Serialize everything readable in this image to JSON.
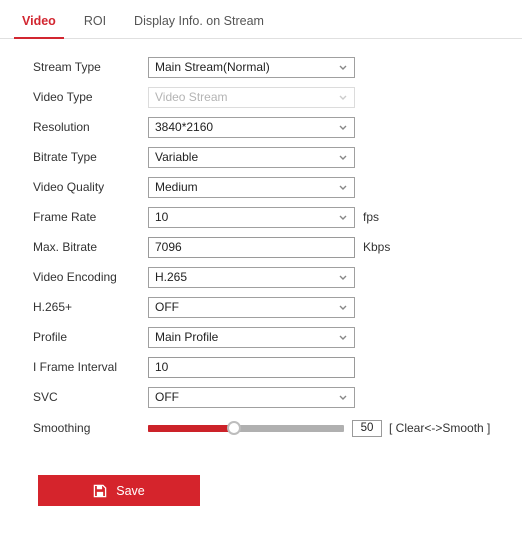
{
  "tabs": [
    {
      "label": "Video",
      "active": true
    },
    {
      "label": "ROI",
      "active": false
    },
    {
      "label": "Display Info. on Stream",
      "active": false
    }
  ],
  "form": {
    "rows": [
      {
        "label": "Stream Type",
        "value": "Main Stream(Normal)",
        "control": "select",
        "unit": "",
        "disabled": false
      },
      {
        "label": "Video Type",
        "value": "Video Stream",
        "control": "select",
        "unit": "",
        "disabled": true
      },
      {
        "label": "Resolution",
        "value": "3840*2160",
        "control": "select",
        "unit": "",
        "disabled": false
      },
      {
        "label": "Bitrate Type",
        "value": "Variable",
        "control": "select",
        "unit": "",
        "disabled": false
      },
      {
        "label": "Video Quality",
        "value": "Medium",
        "control": "select",
        "unit": "",
        "disabled": false
      },
      {
        "label": "Frame Rate",
        "value": "10",
        "control": "select",
        "unit": "fps",
        "disabled": false
      },
      {
        "label": "Max. Bitrate",
        "value": "7096",
        "control": "text",
        "unit": "Kbps",
        "disabled": false
      },
      {
        "label": "Video Encoding",
        "value": "H.265",
        "control": "select",
        "unit": "",
        "disabled": false
      },
      {
        "label": "H.265+",
        "value": "OFF",
        "control": "select",
        "unit": "",
        "disabled": false
      },
      {
        "label": "Profile",
        "value": "Main Profile",
        "control": "select",
        "unit": "",
        "disabled": false
      },
      {
        "label": "I Frame Interval",
        "value": "10",
        "control": "text",
        "unit": "",
        "disabled": false
      },
      {
        "label": "SVC",
        "value": "OFF",
        "control": "select",
        "unit": "",
        "disabled": false
      }
    ],
    "smoothing": {
      "label": "Smoothing",
      "value": "50",
      "hint": "[ Clear<->Smooth ]",
      "percent": 44
    }
  },
  "actions": {
    "save_label": "Save",
    "save_icon": "save-floppy-icon"
  },
  "colors": {
    "accent": "#d22630",
    "save_bg": "#d5242c",
    "slider_fill": "#cc2229",
    "slider_track": "#b0b0b0"
  }
}
